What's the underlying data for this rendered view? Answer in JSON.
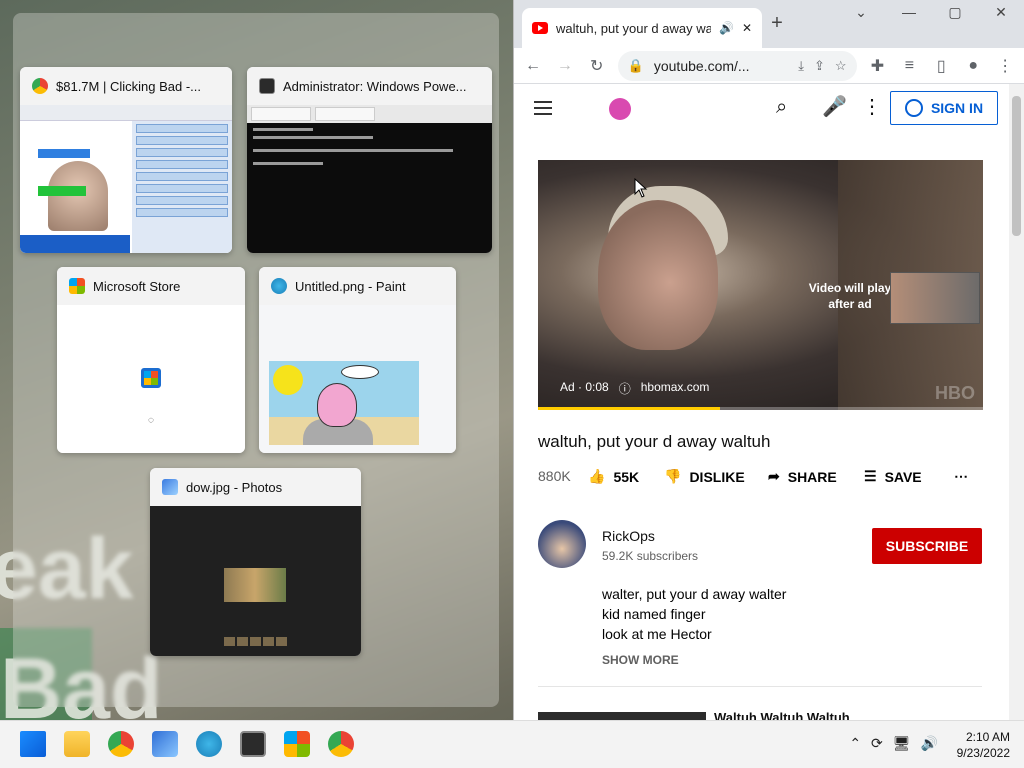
{
  "snap_assist": {
    "windows": [
      {
        "title": "$81.7M | Clicking Bad -...",
        "icon": "chrome-icon"
      },
      {
        "title": "Administrator: Windows Powe...",
        "icon": "powershell-icon"
      },
      {
        "title": "Microsoft Store",
        "icon": "store-icon"
      },
      {
        "title": "Untitled.png - Paint",
        "icon": "paint-icon"
      },
      {
        "title": "dow.jpg - Photos",
        "icon": "photos-icon"
      }
    ]
  },
  "wallpaper": {
    "word1": "eak",
    "word2": "Bad"
  },
  "chrome": {
    "tab_title": "waltuh, put your d away wa",
    "new_tab": "+",
    "url": "youtube.com/...",
    "window_controls": [
      "⌄",
      "—",
      "▢",
      "✕"
    ]
  },
  "youtube": {
    "signin": "SIGN IN",
    "player": {
      "skip_text": "Video will play after ad",
      "ad_label": "Ad · 0:08",
      "ad_domain": "hbomax.com",
      "progress": 0.41,
      "watermark": "HBO"
    },
    "video_title": "waltuh, put your d away waltuh",
    "views": "880K",
    "likes": "55K",
    "dislike": "DISLIKE",
    "share": "SHARE",
    "save": "SAVE",
    "channel": {
      "name": "RickOps",
      "subscribers": "59.2K subscribers",
      "subscribe": "SUBSCRIBE"
    },
    "description": [
      "walter, put your d away walter",
      "kid named finger",
      "look at me Hector"
    ],
    "show_more": "SHOW MORE",
    "next_title": "Waltuh Waltuh Waltuh"
  },
  "taskbar": {
    "time": "2:10 AM",
    "date": "9/23/2022"
  },
  "colors": {
    "accent": "#065fd4",
    "subscribe": "#cc0000",
    "ad_progress": "#ffcc00"
  }
}
